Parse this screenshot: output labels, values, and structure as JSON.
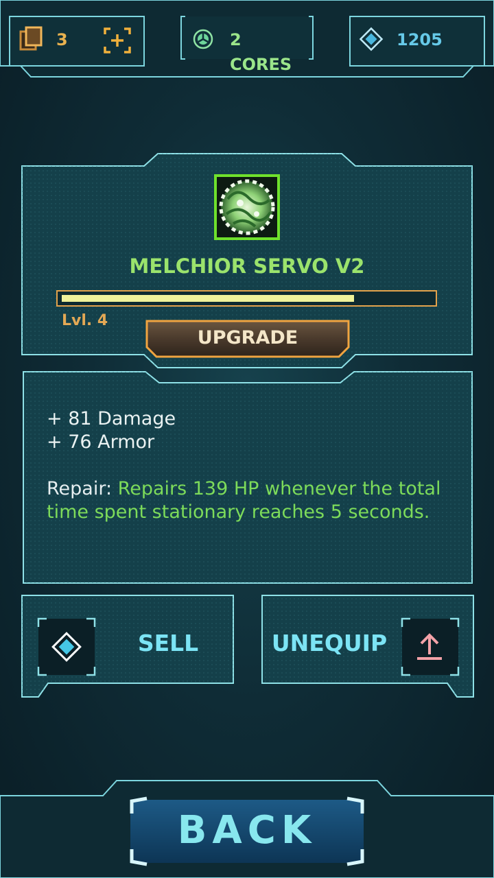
{
  "hud": {
    "cards_count": "3",
    "cores_label": "2 CORES",
    "gems_count": "1205",
    "icons": [
      "cards-icon",
      "add-bracket-icon",
      "core-icon",
      "diamond-icon"
    ]
  },
  "item": {
    "name": "MELCHIOR SERVO V2",
    "level_label": "Lvl. 4",
    "progress_fraction": 0.79,
    "upgrade_label": "UPGRADE",
    "icon": "servo-gear-icon"
  },
  "stats": {
    "damage": "+ 81 Damage",
    "armor": "+ 76 Armor",
    "repair_label": "Repair: ",
    "repair_text": "Repairs 139 HP whenever the total time spent stationary reaches 5 seconds."
  },
  "actions": {
    "sell_label": "SELL",
    "unequip_label": "UNEQUIP",
    "sell_icon": "diamond-icon",
    "unequip_icon": "upload-arrow-icon"
  },
  "footer": {
    "back_label": "BACK"
  },
  "colors": {
    "accent_cyan": "#7ce4f5",
    "item_green": "#9be36c",
    "gold": "#e3a855",
    "progress_fill": "#f0f29a",
    "panel_border": "#8fe2e8"
  }
}
